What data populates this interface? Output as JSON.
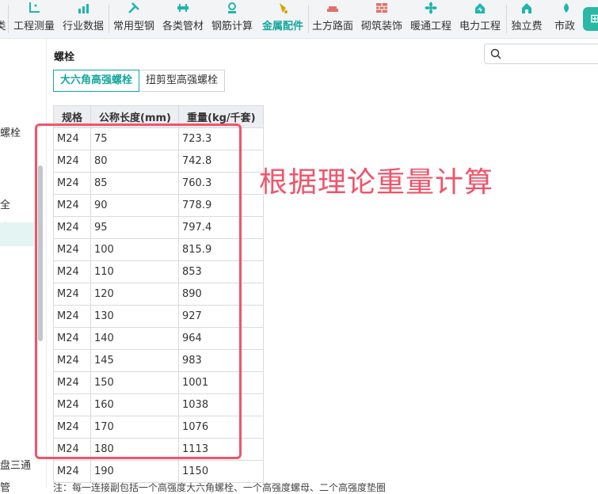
{
  "toolbar": {
    "items": [
      {
        "label": "类",
        "icon": "partial-icon"
      },
      {
        "label": "工程测量",
        "icon": "measure-icon"
      },
      {
        "label": "行业数据",
        "icon": "bar-chart-icon"
      },
      {
        "label": "常用型钢",
        "icon": "tools-icon"
      },
      {
        "label": "各类管材",
        "icon": "pipe-icon"
      },
      {
        "label": "钢筋计算",
        "icon": "rebar-icon"
      },
      {
        "label": "金属配件",
        "icon": "metal-fitting-icon"
      },
      {
        "label": "土方路面",
        "icon": "road-icon"
      },
      {
        "label": "砌筑装饰",
        "icon": "brick-icon"
      },
      {
        "label": "暖通工程",
        "icon": "fan-icon"
      },
      {
        "label": "电力工程",
        "icon": "power-icon"
      },
      {
        "label": "独立费",
        "icon": "house-icon"
      },
      {
        "label": "市政",
        "icon": "city-icon"
      }
    ],
    "active_label": "金属配件"
  },
  "sidebar": {
    "items": [
      {
        "label": "螺栓"
      },
      {
        "label": "全"
      },
      {
        "label": "全"
      },
      {
        "label": "盘三通"
      },
      {
        "label": "管"
      }
    ]
  },
  "main": {
    "section_title": "螺栓",
    "search_placeholder": "",
    "tabs": [
      {
        "label": "大六角高强螺栓",
        "active": true
      },
      {
        "label": "扭剪型高强螺栓",
        "active": false
      }
    ],
    "table": {
      "headers": [
        "规格",
        "公称长度(mm)",
        "重量(kg/千套)"
      ],
      "rows": [
        [
          "M24",
          "75",
          "723.3"
        ],
        [
          "M24",
          "80",
          "742.8"
        ],
        [
          "M24",
          "85",
          "760.3"
        ],
        [
          "M24",
          "90",
          "778.9"
        ],
        [
          "M24",
          "95",
          "797.4"
        ],
        [
          "M24",
          "100",
          "815.9"
        ],
        [
          "M24",
          "110",
          "853"
        ],
        [
          "M24",
          "120",
          "890"
        ],
        [
          "M24",
          "130",
          "927"
        ],
        [
          "M24",
          "140",
          "964"
        ],
        [
          "M24",
          "145",
          "983"
        ],
        [
          "M24",
          "150",
          "1001"
        ],
        [
          "M24",
          "160",
          "1038"
        ],
        [
          "M24",
          "170",
          "1076"
        ],
        [
          "M24",
          "180",
          "1113"
        ],
        [
          "M24",
          "190",
          "1150"
        ]
      ]
    },
    "note": "注：每一连接副包括一个高强度大六角螺栓、一个高强度螺母、二个高强度垫圈"
  },
  "annotation": {
    "text": "根据理论重量计算",
    "color": "#f0546a"
  },
  "colors": {
    "accent": "#13a89e",
    "highlight": "#f0546a",
    "active_icon": "#d9a300"
  }
}
